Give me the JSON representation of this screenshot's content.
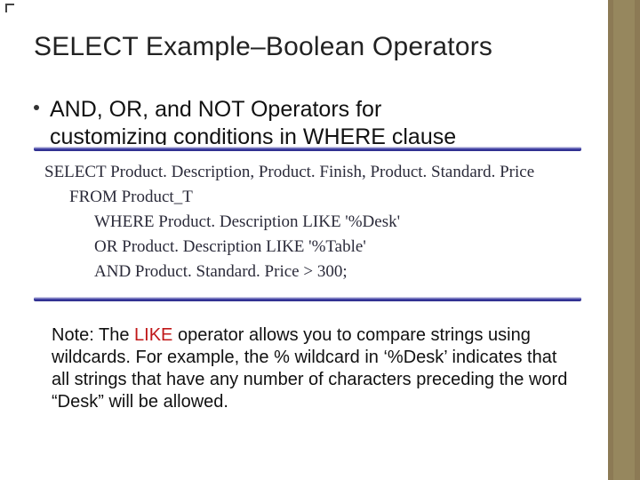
{
  "title": "SELECT Example–Boolean Operators",
  "bullet": {
    "line1": "AND, OR, and NOT Operators for",
    "line2": "customizing conditions in WHERE clause"
  },
  "code": {
    "l1": "SELECT Product. Description, Product. Finish, Product. Standard. Price",
    "l2": "FROM Product_T",
    "l3": "WHERE Product. Description LIKE '%Desk'",
    "l4": "OR Product. Description LIKE '%Table'",
    "l5": "AND Product. Standard. Price > 300;"
  },
  "note": {
    "prefix": "Note: The ",
    "like": "LIKE",
    "rest": " operator allows you to compare strings using wildcards. For example, the % wildcard in ‘%Desk’ indicates that all strings that have any number of characters preceding the word “Desk” will be allowed."
  },
  "colors": {
    "stripe": "#8c7a55",
    "bar": "#3a3aa0",
    "like": "#c01718"
  }
}
